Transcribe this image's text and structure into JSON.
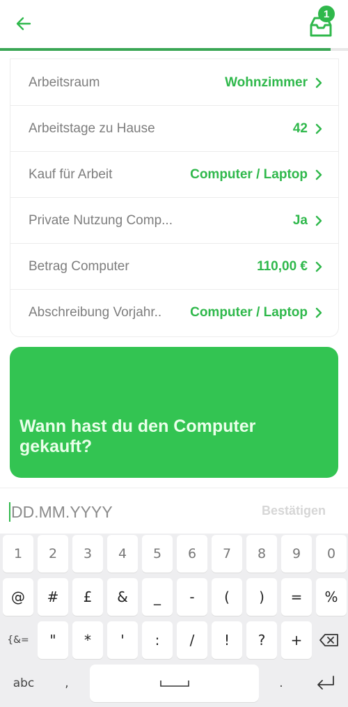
{
  "header": {
    "back_icon": "arrow-left-icon",
    "inbox_icon": "inbox-tray-icon",
    "inbox_badge_count": "1",
    "progress_percent": 95,
    "accent_color": "#2fb84b"
  },
  "details": {
    "rows": [
      {
        "label": "Arbeitsraum",
        "value": "Wohnzimmer"
      },
      {
        "label": "Arbeitstage zu Hause",
        "value": "42"
      },
      {
        "label": "Kauf für Arbeit",
        "value": "Computer / Laptop"
      },
      {
        "label": "Private Nutzung Comp...",
        "value": "Ja"
      },
      {
        "label": "Betrag Computer",
        "value": "110,00 €"
      },
      {
        "label": "Abschreibung Vorjahr..",
        "value": "Computer / Laptop"
      }
    ]
  },
  "question": {
    "text": "Wann hast du den Computer gekauft?",
    "background_color": "#33c452"
  },
  "input": {
    "value": "",
    "placeholder": "DD.MM.YYYY",
    "confirm_label": "Bestätigen"
  },
  "keyboard": {
    "row1": [
      "1",
      "2",
      "3",
      "4",
      "5",
      "6",
      "7",
      "8",
      "9",
      "0"
    ],
    "row2": [
      "@",
      "#",
      "£",
      "&",
      "_",
      "-",
      "(",
      ")",
      "=",
      "%"
    ],
    "row3_toggle": "{&=",
    "row3": [
      "\"",
      "*",
      "'",
      ":",
      "/",
      "!",
      "?",
      "+"
    ],
    "abc_label": "abc",
    "comma": ",",
    "period": ".",
    "backspace_icon": "backspace-icon",
    "enter_icon": "enter-icon",
    "space_icon": "space-icon"
  }
}
